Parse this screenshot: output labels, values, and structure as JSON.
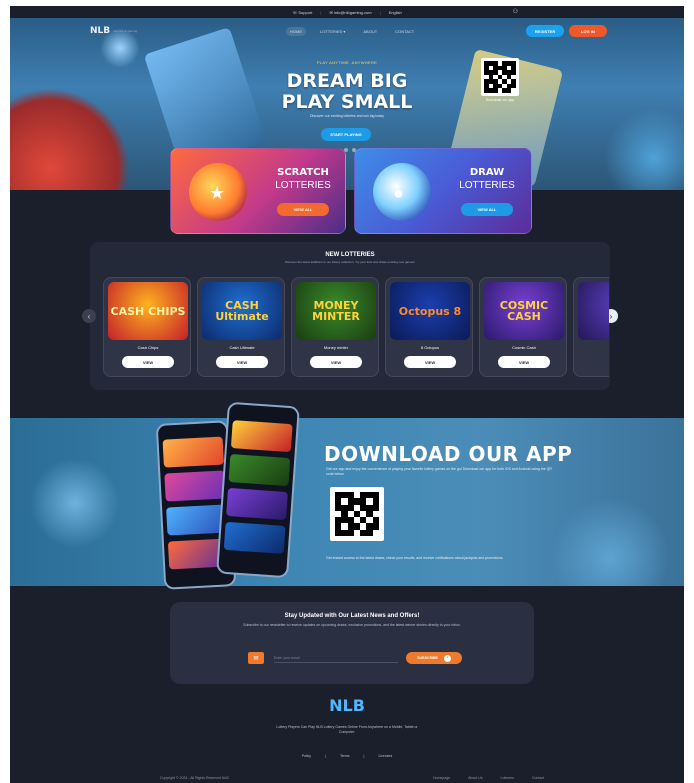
{
  "topbar": {
    "support": "Support",
    "email": "info@nlbgaming.com",
    "language": "English"
  },
  "nav": {
    "logo": "NLB",
    "logo_sub": "lotteries & gaming",
    "menu": [
      "HOME",
      "LOTTERIES",
      "ABOUT",
      "CONTACT"
    ],
    "register": "REGISTER",
    "login": "LOG IN"
  },
  "hero": {
    "kicker": "PLAY ANYTIME, ANYWHERE",
    "title_line1": "DREAM BIG",
    "title_line2": "PLAY SMALL",
    "tagline": "Discover our exciting lotteries and win big today",
    "cta": "START PLAYING",
    "qr_label": "Download our app"
  },
  "categories": [
    {
      "title": "SCRATCH",
      "subtitle": "LOTTERIES",
      "button": "VIEW ALL"
    },
    {
      "title": "DRAW",
      "subtitle": "LOTTERIES",
      "button": "VIEW ALL"
    }
  ],
  "new_lotteries": {
    "title": "NEW LOTTERIES",
    "subtitle": "Discover the latest additions to our lottery collection. Try your luck and chase exciting new games!",
    "cards": [
      {
        "name": "Cash Chips",
        "art": "CASH CHIPS",
        "button": "VIEW",
        "c1": "#ffb21e",
        "c2": "#c41f2a",
        "fg": "#fff3a0"
      },
      {
        "name": "Cash Ultimate",
        "art": "CASH Ultimate",
        "button": "VIEW",
        "c1": "#1f6fd1",
        "c2": "#0d2a6b",
        "fg": "#ffd23a"
      },
      {
        "name": "Money minter",
        "art": "MONEY MINTER",
        "button": "VIEW",
        "c1": "#3a8a2a",
        "c2": "#1a3d12",
        "fg": "#ffd23a"
      },
      {
        "name": "8 Octopus",
        "art": "Octopus 8",
        "button": "VIEW",
        "c1": "#1b3fae",
        "c2": "#0b1a57",
        "fg": "#ff8a2a"
      },
      {
        "name": "Cosmic Cash",
        "art": "COSMIC CASH",
        "button": "VIEW",
        "c1": "#7a3fd4",
        "c2": "#2a1a6b",
        "fg": "#ffd23a"
      },
      {
        "name": "",
        "art": "",
        "button": "",
        "c1": "#5a3fbf",
        "c2": "#231755",
        "fg": "#ffd23a"
      }
    ]
  },
  "download": {
    "title": "DOWNLOAD OUR APP",
    "text": "Get our app and enjoy the convenience of playing your favorite lottery games on the go! Download our app for both iOS and Android using the QR code below.",
    "text2": "Get instant access to the latest draws, check your results, and receive notifications about jackpots and promotions."
  },
  "newsletter": {
    "title": "Stay Updated with Our Latest News and Offers!",
    "text": "Subscribe to our newsletter to receive updates on upcoming draws, exclusive promotions, and the latest winner stories directly to your inbox.",
    "placeholder": "Enter your email",
    "button": "SUBSCRIBE"
  },
  "footer": {
    "logo": "NLB",
    "description": "Lottery Players Can Play NLB Lottery Games Online From Anywhere on a Mobile, Tablet or Computer.",
    "links": [
      "Policy",
      "|",
      "Terms",
      "|",
      "Licenses"
    ],
    "copyright": "Copyright © 2024 - All Rights Reserved NLB",
    "bottom_links": [
      "Homepage",
      "About Us",
      "Lotteries",
      "Contact"
    ]
  },
  "colors": {
    "page_bg": "#1b1f2b",
    "accent_blue": "#1e9be6",
    "accent_orange": "#f07a2b"
  }
}
